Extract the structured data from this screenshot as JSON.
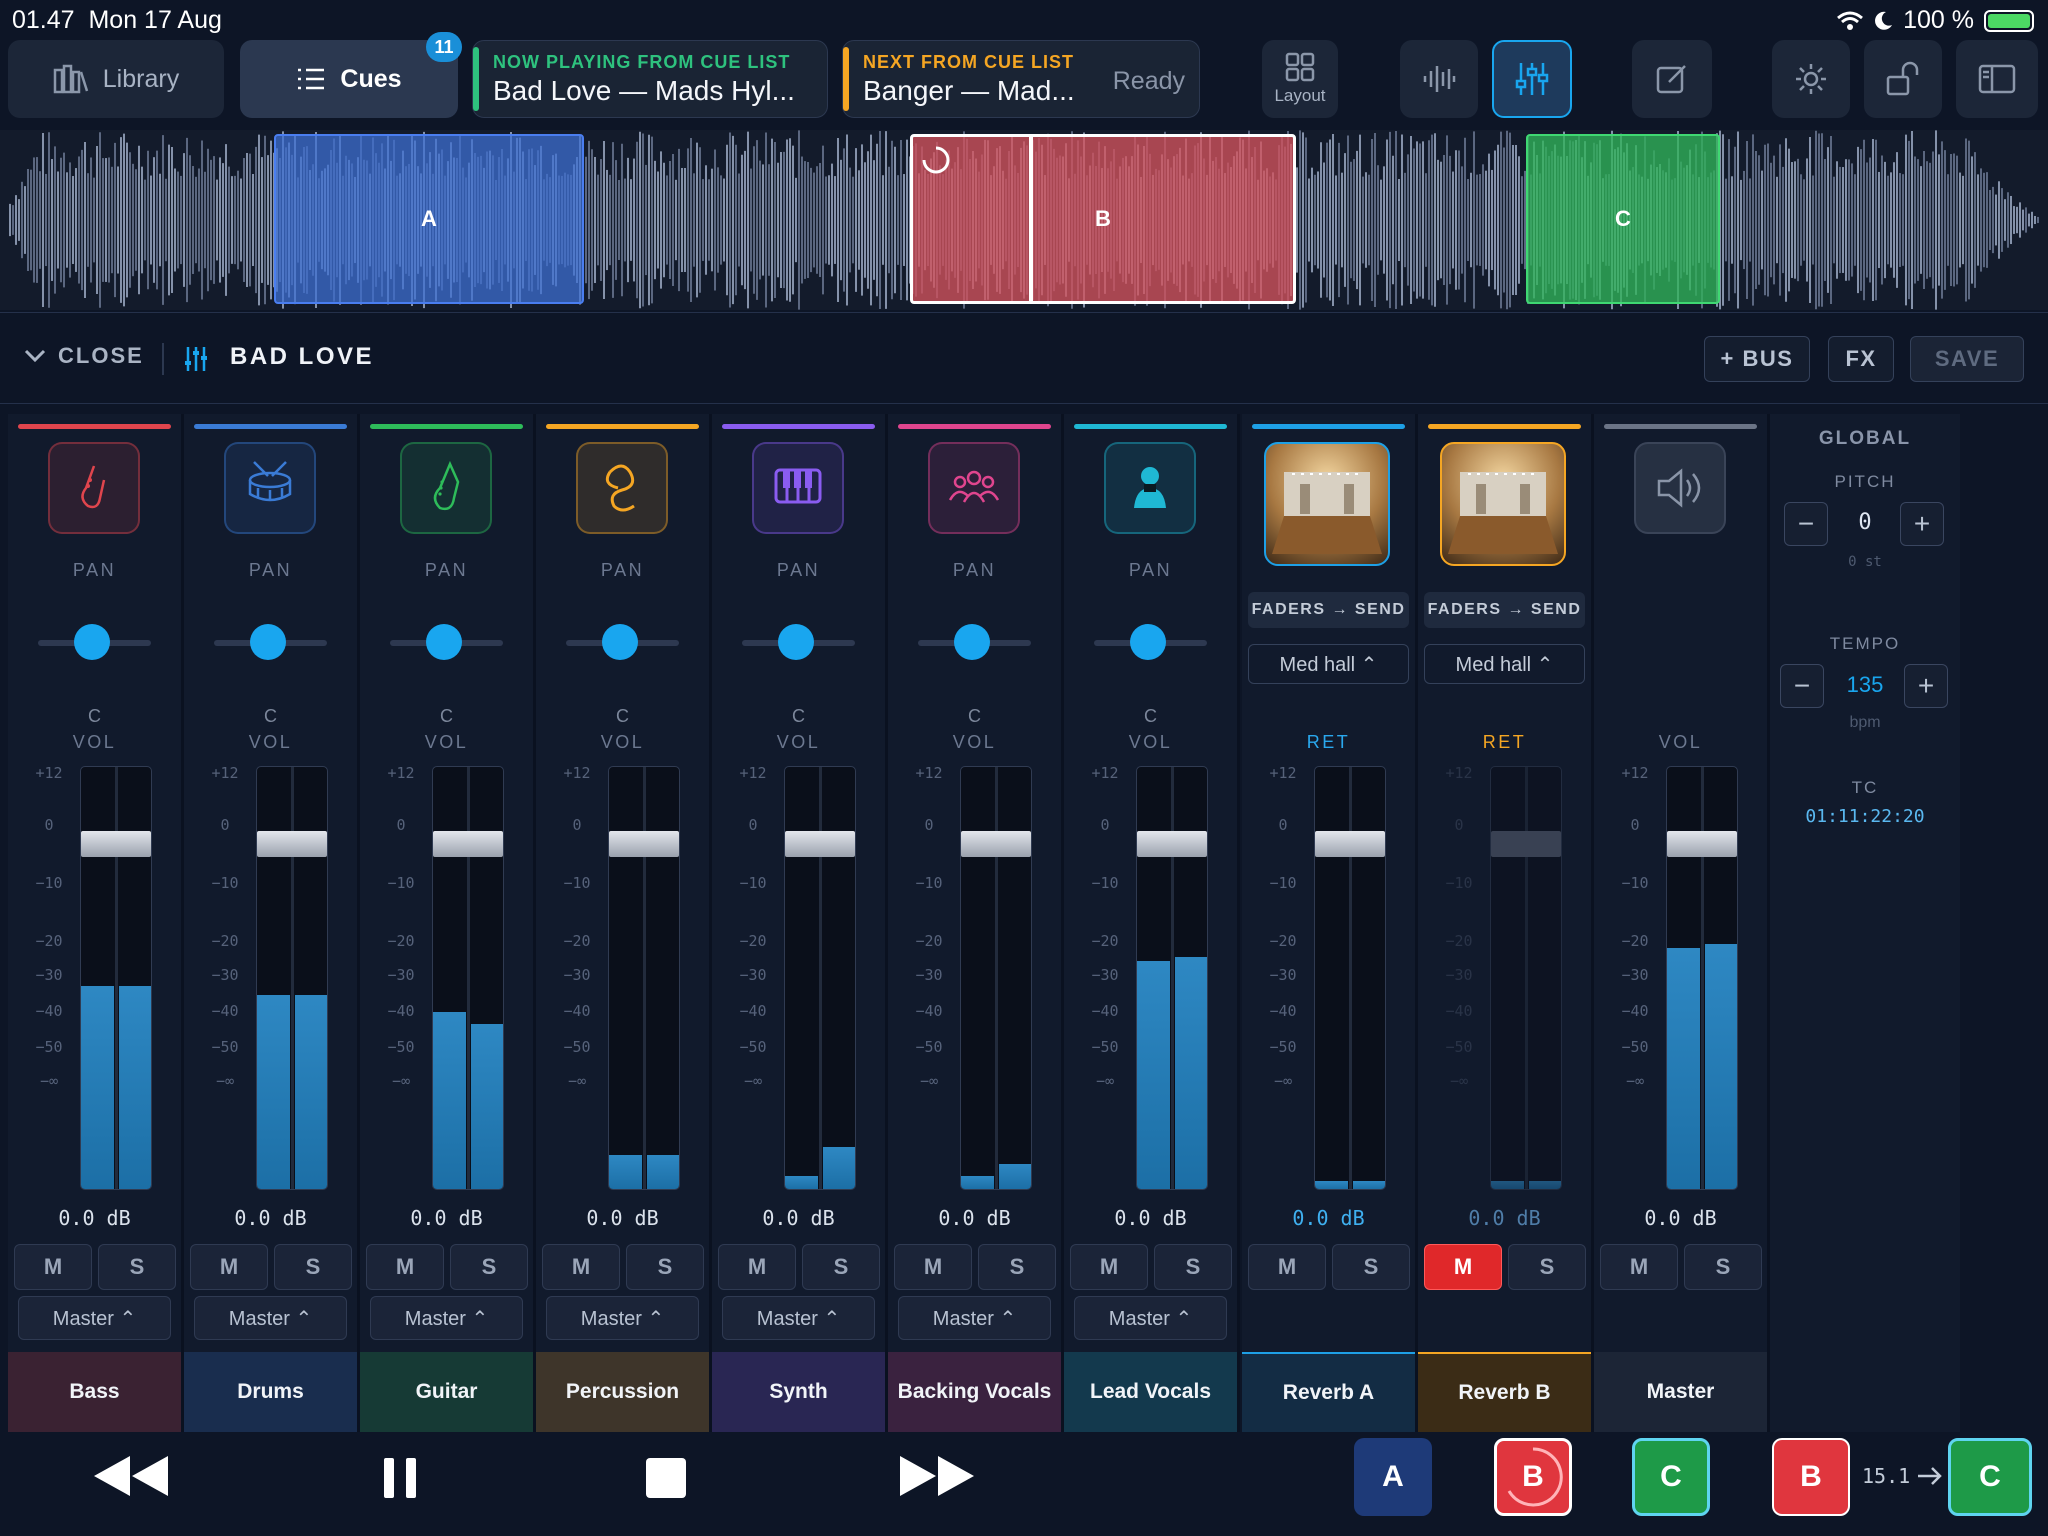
{
  "status": {
    "time": "01.47",
    "date": "Mon 17 Aug",
    "battery": "100 %"
  },
  "toolbar": {
    "library_label": "Library",
    "cues_label": "Cues",
    "cues_badge": "11",
    "now_playing_label": "NOW PLAYING FROM CUE LIST",
    "now_playing_title": "Bad Love — Mads Hyl...",
    "next_label": "NEXT FROM CUE LIST",
    "next_title": "Banger — Mad...",
    "next_status": "Ready",
    "layout_label": "Layout"
  },
  "colors": {
    "accent": "#19a6ef",
    "now_playing": "#2ec27e",
    "next": "#f5a623",
    "mute_active": "#e0282a"
  },
  "waveform": {
    "regions": [
      {
        "label": "A",
        "color": "#3d6fd1"
      },
      {
        "label": "B",
        "color": "#d2525c"
      },
      {
        "label": "C",
        "color": "#2fb35a"
      }
    ]
  },
  "mixer": {
    "close_label": "CLOSE",
    "title": "BAD LOVE",
    "bus_label": "+ BUS",
    "fx_label": "FX",
    "save_label": "SAVE",
    "pan_label": "PAN",
    "vol_label": "VOL",
    "ret_label": "RET",
    "send_label": "FADERS → SEND",
    "scale": [
      "+12",
      "0",
      "−10",
      "−20",
      "−30",
      "−40",
      "−50",
      "−∞"
    ],
    "mute_label": "M",
    "solo_label": "S",
    "channels": [
      {
        "name": "Bass",
        "color": "#e0454d",
        "icon": "bass-guitar-icon",
        "pan": "C",
        "db": "0.0 dB",
        "route": "Master ⌃",
        "meter_l": 0.48,
        "meter_r": 0.48
      },
      {
        "name": "Drums",
        "color": "#3a7bd5",
        "icon": "drum-icon",
        "pan": "C",
        "db": "0.0 dB",
        "route": "Master ⌃",
        "meter_l": 0.46,
        "meter_r": 0.46
      },
      {
        "name": "Guitar",
        "color": "#2ebc5a",
        "icon": "guitar-icon",
        "pan": "C",
        "db": "0.0 dB",
        "route": "Master ⌃",
        "meter_l": 0.42,
        "meter_r": 0.39
      },
      {
        "name": "Percussion",
        "color": "#f5a623",
        "icon": "percussion-icon",
        "pan": "C",
        "db": "0.0 dB",
        "route": "Master ⌃",
        "meter_l": 0.08,
        "meter_r": 0.08
      },
      {
        "name": "Synth",
        "color": "#8a5cf0",
        "icon": "keyboard-icon",
        "pan": "C",
        "db": "0.0 dB",
        "route": "Master ⌃",
        "meter_l": 0.03,
        "meter_r": 0.1
      },
      {
        "name": "Backing Vocals",
        "color": "#e0458e",
        "icon": "group-icon",
        "pan": "C",
        "db": "0.0 dB",
        "route": "Master ⌃",
        "meter_l": 0.03,
        "meter_r": 0.06
      },
      {
        "name": "Lead Vocals",
        "color": "#1fb8d4",
        "icon": "singer-icon",
        "pan": "C",
        "db": "0.0 dB",
        "route": "Master ⌃",
        "meter_l": 0.54,
        "meter_r": 0.55
      }
    ],
    "returns": [
      {
        "name": "Reverb A",
        "color": "#1ea0e6",
        "hall": "Med hall ⌃",
        "db": "0.0 dB",
        "ret_color": "#2aa8ee",
        "muted": false
      },
      {
        "name": "Reverb B",
        "color": "#f5a623",
        "hall": "Med hall ⌃",
        "db": "0.0 dB",
        "ret_color": "#f5a623",
        "muted": true
      }
    ],
    "master": {
      "name": "Master",
      "db": "0.0 dB",
      "meter_l": 0.57,
      "meter_r": 0.58
    }
  },
  "global": {
    "title": "GLOBAL",
    "pitch_label": "PITCH",
    "pitch_value": "0",
    "pitch_unit": "0 st",
    "tempo_label": "TEMPO",
    "tempo_value": "135",
    "tempo_unit": "bpm",
    "tc_label": "TC",
    "tc_value": "01:11:22:20",
    "minus": "−",
    "plus": "+"
  },
  "transport": {
    "pads": [
      {
        "label": "A",
        "color": "#1e3a78"
      },
      {
        "label": "B",
        "color": "#e0363e"
      },
      {
        "label": "C",
        "color": "#1e9a48"
      },
      {
        "label": "B",
        "color": "#e0363e"
      },
      {
        "label": "C",
        "color": "#1e9a48"
      }
    ],
    "queue_time": "15.1"
  }
}
